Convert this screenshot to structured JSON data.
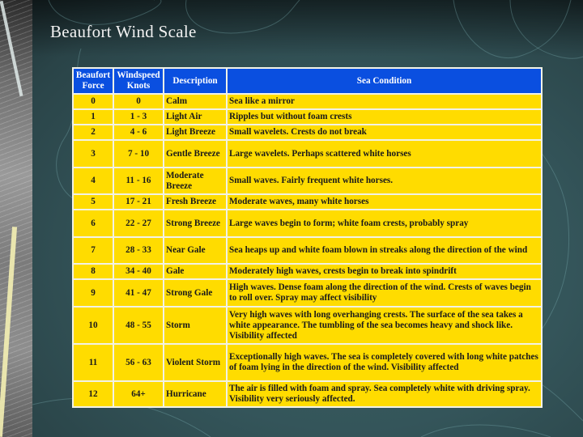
{
  "slide": {
    "title": "Beaufort Wind Scale"
  },
  "table": {
    "headers": {
      "force": "Beaufort Force",
      "knots": "Windspeed Knots",
      "description": "Description",
      "condition": "Sea Condition"
    },
    "rows": [
      {
        "force": "0",
        "knots": "0",
        "description": "Calm",
        "condition": "Sea like a mirror"
      },
      {
        "force": "1",
        "knots": "1 - 3",
        "description": "Light Air",
        "condition": "Ripples but without foam crests"
      },
      {
        "force": "2",
        "knots": "4 - 6",
        "description": "Light Breeze",
        "condition": "Small wavelets. Crests do not break"
      },
      {
        "force": "3",
        "knots": "7 - 10",
        "description": "Gentle Breeze",
        "condition": "Large wavelets. Perhaps scattered white horses"
      },
      {
        "force": "4",
        "knots": "11 - 16",
        "description": "Moderate Breeze",
        "condition": "Small waves. Fairly frequent white horses."
      },
      {
        "force": "5",
        "knots": "17 - 21",
        "description": "Fresh Breeze",
        "condition": "Moderate waves, many white horses"
      },
      {
        "force": "6",
        "knots": "22 - 27",
        "description": "Strong Breeze",
        "condition": "Large waves begin to form; white foam crests, probably spray"
      },
      {
        "force": "7",
        "knots": "28 - 33",
        "description": "Near Gale",
        "condition": "Sea heaps up and white foam blown in streaks along the direction of the wind"
      },
      {
        "force": "8",
        "knots": "34 - 40",
        "description": "Gale",
        "condition": "Moderately high waves, crests begin to break into spindrift"
      },
      {
        "force": "9",
        "knots": "41 - 47",
        "description": "Strong Gale",
        "condition": "High waves. Dense foam along the direction of the wind. Crests of waves begin to roll over. Spray may affect visibility"
      },
      {
        "force": "10",
        "knots": "48 - 55",
        "description": "Storm",
        "condition": "Very high waves with long overhanging crests. The surface of the sea takes a white appearance. The tumbling of the sea becomes heavy and shock like. Visibility affected"
      },
      {
        "force": "11",
        "knots": "56 - 63",
        "description": "Violent Storm",
        "condition": "Exceptionally high waves. The sea is completely covered with long white patches of foam lying in the direction of the wind. Visibility affected"
      },
      {
        "force": "12",
        "knots": "64+",
        "description": "Hurricane",
        "condition": "The air is filled with foam and spray. Sea completely white with driving spray. Visibility very seriously affected."
      }
    ]
  },
  "colors": {
    "header_bg": "#0a4fe0",
    "cell_bg": "#ffdc00",
    "slide_bg": "#34555a"
  }
}
